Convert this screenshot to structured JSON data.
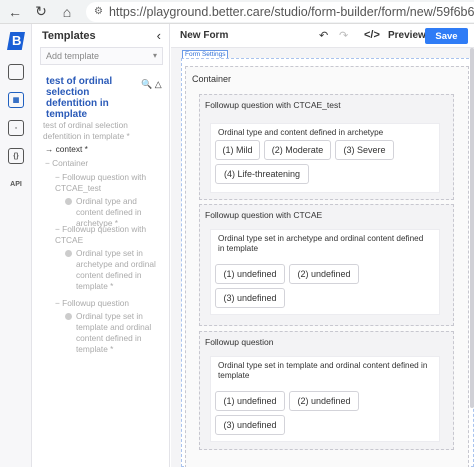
{
  "browser": {
    "url": "https://playground.better.care/studio/form-builder/form/new/59f6b64e-d6d1-4"
  },
  "rail": {
    "logo_letter": "B",
    "api_label": "API",
    "code_label": "{}"
  },
  "templates": {
    "header": "Templates",
    "add_placeholder": "Add template",
    "title": "test of ordinal selection defentition in template",
    "tree": {
      "root": "test of ordinal selection defentition in template *",
      "context": "context *",
      "container": "Container",
      "fq1": "Followup question with CTCAE_test",
      "fq1_child": "Ordinal type and content defined in archetype *",
      "fq2": "Followup question with CTCAE",
      "fq2_child": "Ordinal type set in archetype and ordinal content defined in template *",
      "fq3": "Followup question",
      "fq3_child": "Ordinal type set in template and ordinal content defined in template *"
    }
  },
  "header": {
    "form_name": "New Form",
    "preview": "Preview",
    "save": "Save"
  },
  "canvas": {
    "form_settings": "Form Settings",
    "container": "Container",
    "q1": {
      "title": "Followup question with CTCAE_test",
      "label": "Ordinal type and content defined in archetype",
      "options": [
        "(1) Mild",
        "(2) Moderate",
        "(3) Severe",
        "(4) Life-threatening"
      ]
    },
    "q2": {
      "title": "Followup question with CTCAE",
      "label": "Ordinal type set in archetype and ordinal content defined in template",
      "options": [
        "(1) undefined",
        "(2) undefined",
        "(3) undefined"
      ]
    },
    "q3": {
      "title": "Followup question",
      "label": "Ordinal type set in template and ordinal content defined in template",
      "options": [
        "(1) undefined",
        "(2) undefined",
        "(3) undefined"
      ]
    }
  }
}
